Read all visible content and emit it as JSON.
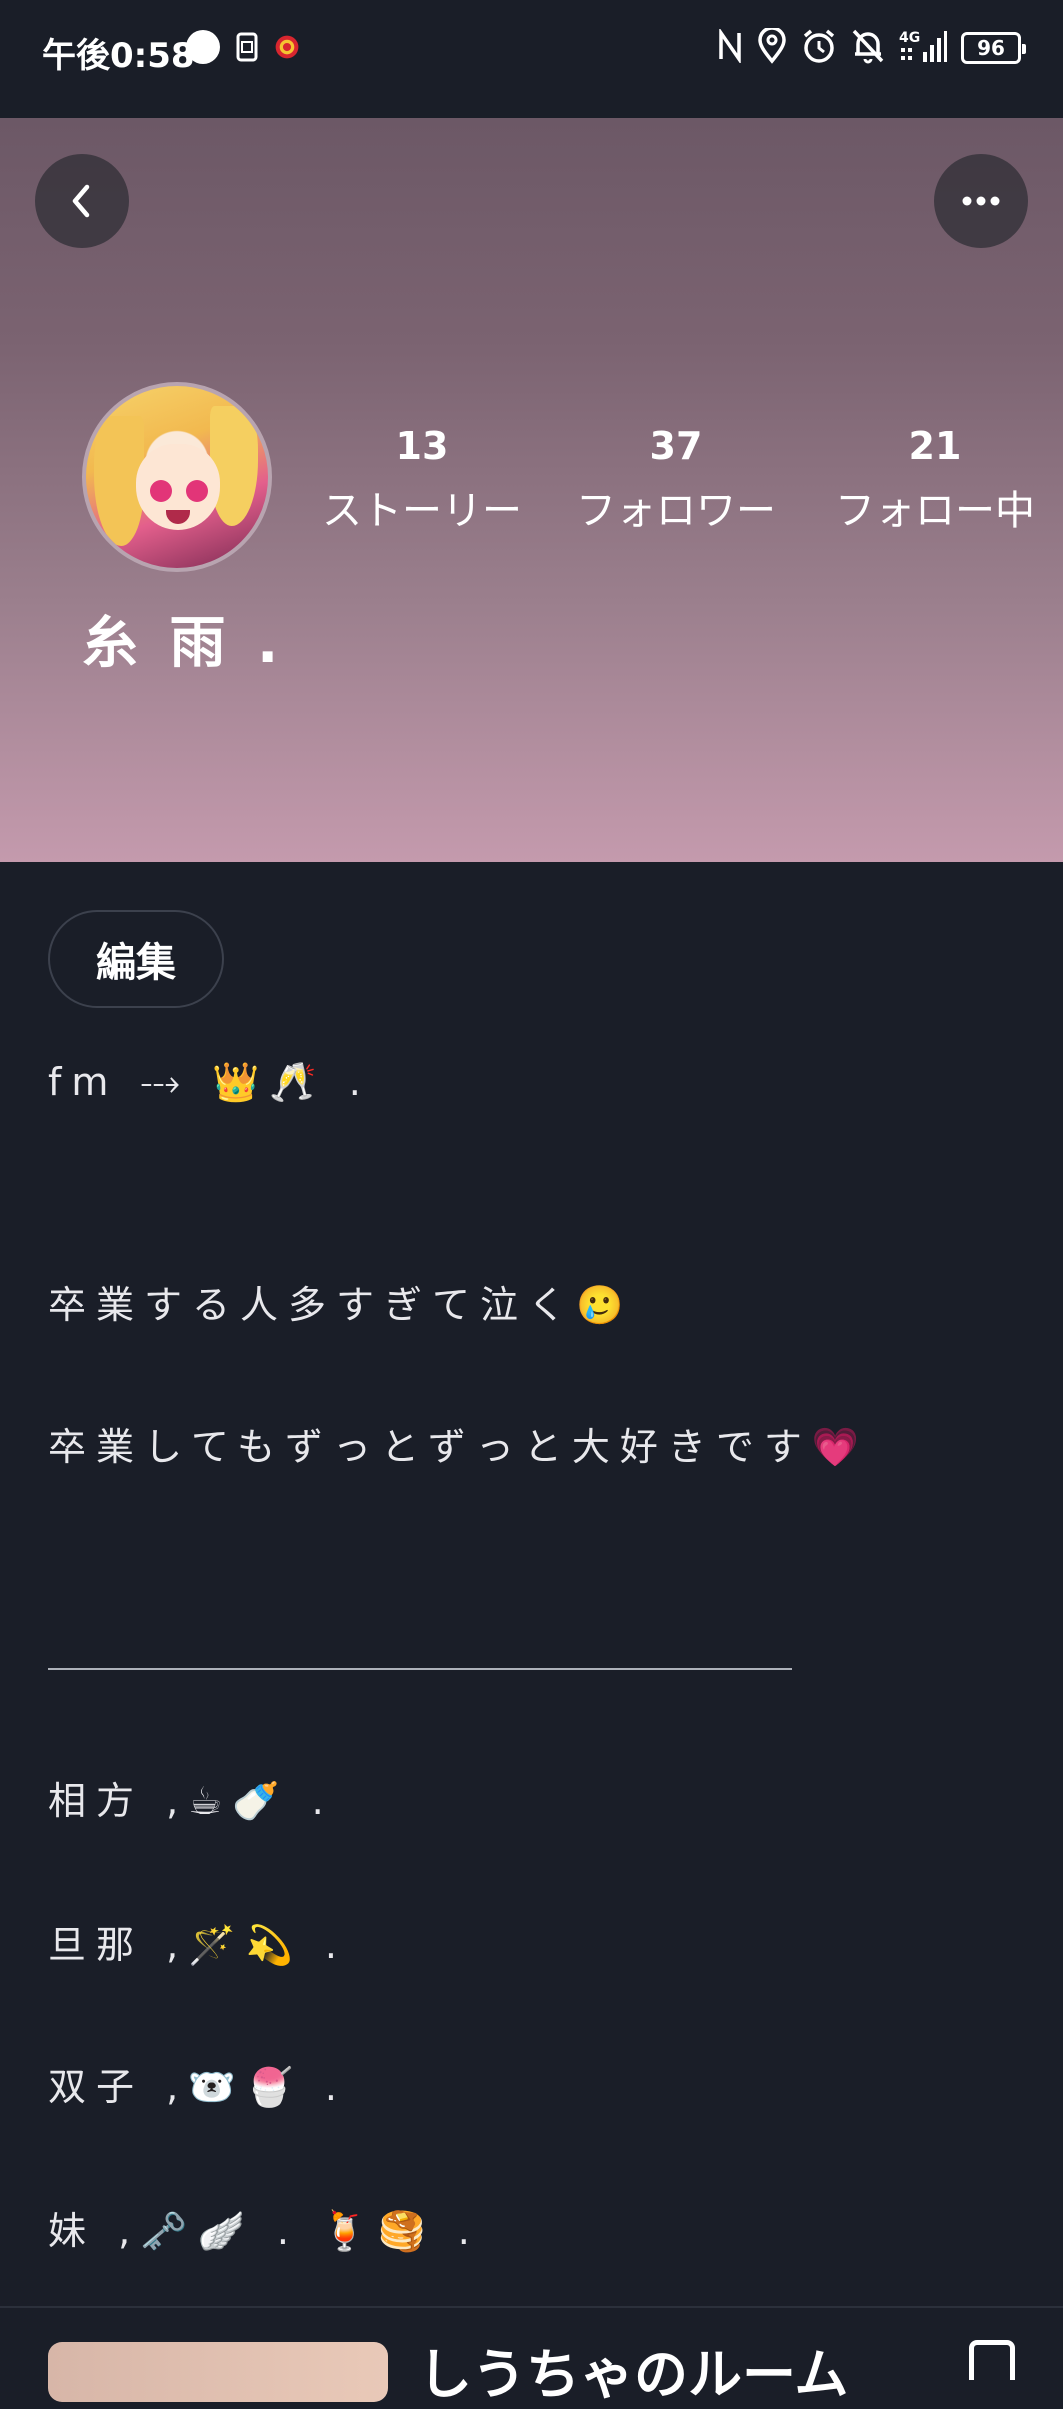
{
  "status_bar": {
    "time": "午後0:58",
    "battery": "96",
    "icons": [
      "record-dot-icon",
      "sim-icon",
      "app-notification-icon",
      "nfc-icon",
      "location-icon",
      "alarm-icon",
      "bell-off-icon",
      "signal-4g-icon",
      "battery-icon"
    ]
  },
  "header": {
    "back_icon": "chevron-left-icon",
    "more_icon": "more-horizontal-icon"
  },
  "profile": {
    "display_name": "糸 雨 .",
    "stats": [
      {
        "count": "13",
        "label": "ストーリー"
      },
      {
        "count": "37",
        "label": "フォロワー"
      },
      {
        "count": "21",
        "label": "フォロー中"
      }
    ],
    "edit_label": "編集"
  },
  "bio": {
    "lines": [
      "fm ⤏ 👑🥂 .",
      "卒業する人多すぎて泣く🥲",
      "卒業してもずっとずっと大好きです💗",
      "相方 ,☕🍼 .",
      "旦那 ,🪄💫 .",
      "双子 ,🐻‍❄️🍧 .",
      " 妹  ,🗝️🪽 . 🍹🥞 ."
    ]
  },
  "room": {
    "title": "しうちゃのルーム"
  },
  "colors": {
    "background": "#1a1e28",
    "hero_top": "#6c5866",
    "hero_bottom": "#c49aad"
  }
}
